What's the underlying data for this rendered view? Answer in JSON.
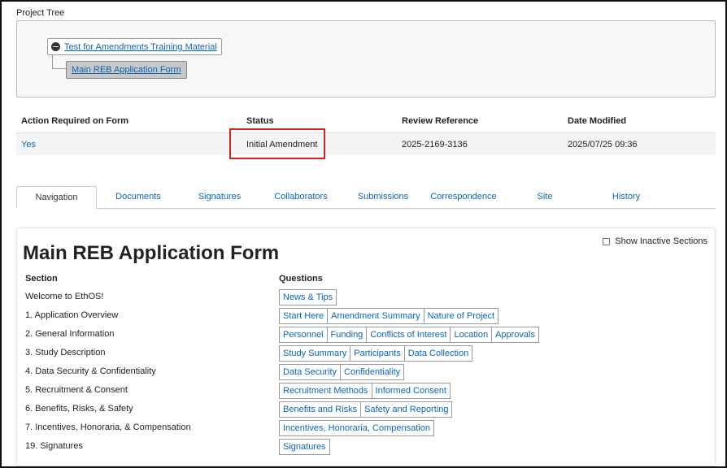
{
  "project_tree": {
    "label": "Project Tree",
    "root_label": "Test for Amendments Training Material",
    "child_label": "Main REB Application Form"
  },
  "summary_table": {
    "headers": [
      "Action Required on Form",
      "Status",
      "Review Reference",
      "Date Modified"
    ],
    "row": {
      "action_required": "Yes",
      "status": "Initial Amendment",
      "review_reference": "2025-2169-3136",
      "date_modified": "2025/07/25 09:36"
    }
  },
  "tabs": [
    "Navigation",
    "Documents",
    "Signatures",
    "Collaborators",
    "Submissions",
    "Correspondence",
    "Site",
    "History"
  ],
  "active_tab": "Navigation",
  "form": {
    "title": "Main REB Application Form",
    "show_inactive_label": "Show Inactive Sections",
    "section_header": "Section",
    "questions_header": "Questions",
    "sections": [
      {
        "label": "Welcome to EthOS!",
        "questions": [
          "News & Tips"
        ]
      },
      {
        "label": "1. Application Overview",
        "questions": [
          "Start Here",
          "Amendment Summary",
          "Nature of Project"
        ]
      },
      {
        "label": "2. General Information",
        "questions": [
          "Personnel",
          "Funding",
          "Conflicts of Interest",
          "Location",
          "Approvals"
        ]
      },
      {
        "label": "3. Study Description",
        "questions": [
          "Study Summary",
          "Participants",
          "Data Collection"
        ]
      },
      {
        "label": "4. Data Security & Confidentiality",
        "questions": [
          "Data Security",
          "Confidentiality"
        ]
      },
      {
        "label": "5. Recruitment & Consent",
        "questions": [
          "Recruitment Methods",
          "Informed Consent"
        ]
      },
      {
        "label": "6. Benefits, Risks, & Safety",
        "questions": [
          "Benefits and Risks",
          "Safety and Reporting"
        ]
      },
      {
        "label": "7. Incentives, Honoraria, & Compensation",
        "questions": [
          "Incentives, Honoraria, Compensation"
        ]
      },
      {
        "label": "19. Signatures",
        "questions": [
          "Signatures"
        ]
      }
    ]
  },
  "colors": {
    "link": "#0a66b8",
    "highlight": "#d62020"
  }
}
